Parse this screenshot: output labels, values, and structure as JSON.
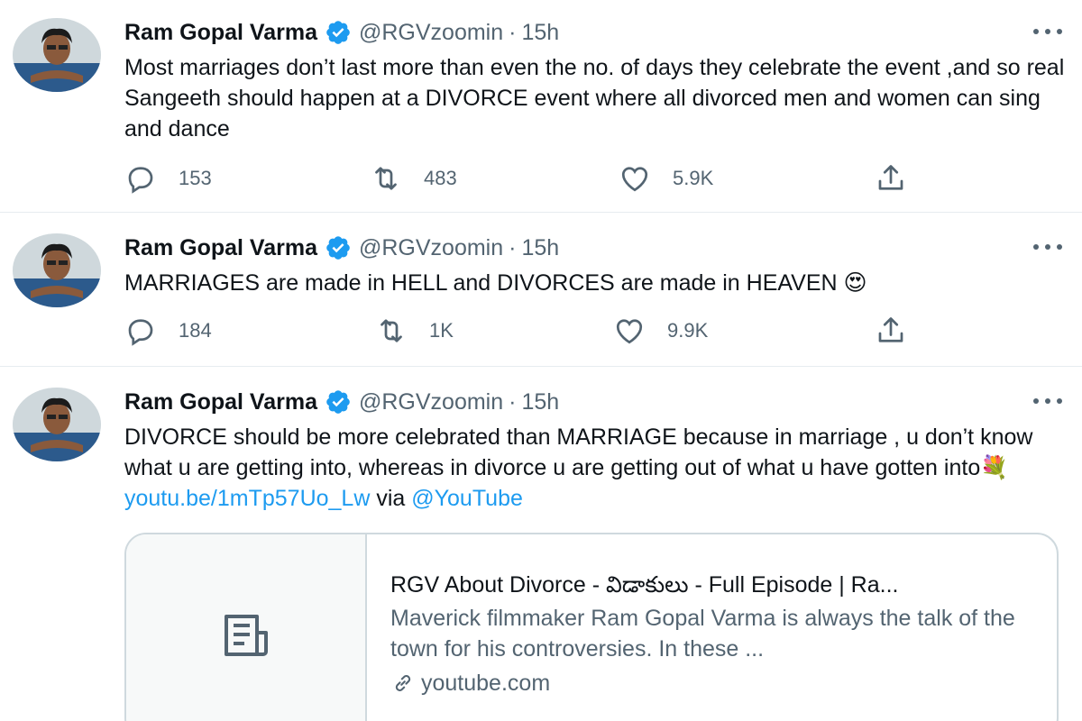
{
  "tweets": [
    {
      "name": "Ram Gopal Varma",
      "handle": "@RGVzoomin",
      "dot": "·",
      "time": "15h",
      "text": "Most marriages don’t last more than even the no. of days they celebrate the event ,and so real Sangeeth should happen at a DIVORCE event where all divorced men and women can sing and dance",
      "replies": "153",
      "retweets": "483",
      "likes": "5.9K"
    },
    {
      "name": "Ram Gopal Varma",
      "handle": "@RGVzoomin",
      "dot": "·",
      "time": "15h",
      "text": "MARRIAGES are made in HELL and DIVORCES are made in HEAVEN 😍",
      "replies": "184",
      "retweets": "1K",
      "likes": "9.9K"
    },
    {
      "name": "Ram Gopal Varma",
      "handle": "@RGVzoomin",
      "dot": "·",
      "time": "15h",
      "text": "DIVORCE should be more celebrated than MARRIAGE because in marriage , u don’t know what u are getting into,  whereas in divorce u are getting out of what u have gotten into💐 ",
      "link": "youtu.be/1mTp57Uo_Lw",
      "via": " via ",
      "mention": "@YouTube",
      "card": {
        "title": "RGV About Divorce - విడాకులు - Full Episode | Ra...",
        "description": "Maverick filmmaker Ram Gopal Varma is always the talk of the town for his controversies. In these ...",
        "domain": "youtube.com"
      }
    }
  ],
  "icons": {
    "avatar": "avatar",
    "verified": "verified-badge-icon",
    "more": "more-icon",
    "reply": "reply-icon",
    "retweet": "retweet-icon",
    "like": "like-icon",
    "share": "share-icon",
    "article": "article-icon",
    "link": "link-icon"
  },
  "colors": {
    "accent": "#1d9bf0",
    "secondary_text": "#536471",
    "primary_text": "#0f1419",
    "border": "#cfd9de"
  }
}
